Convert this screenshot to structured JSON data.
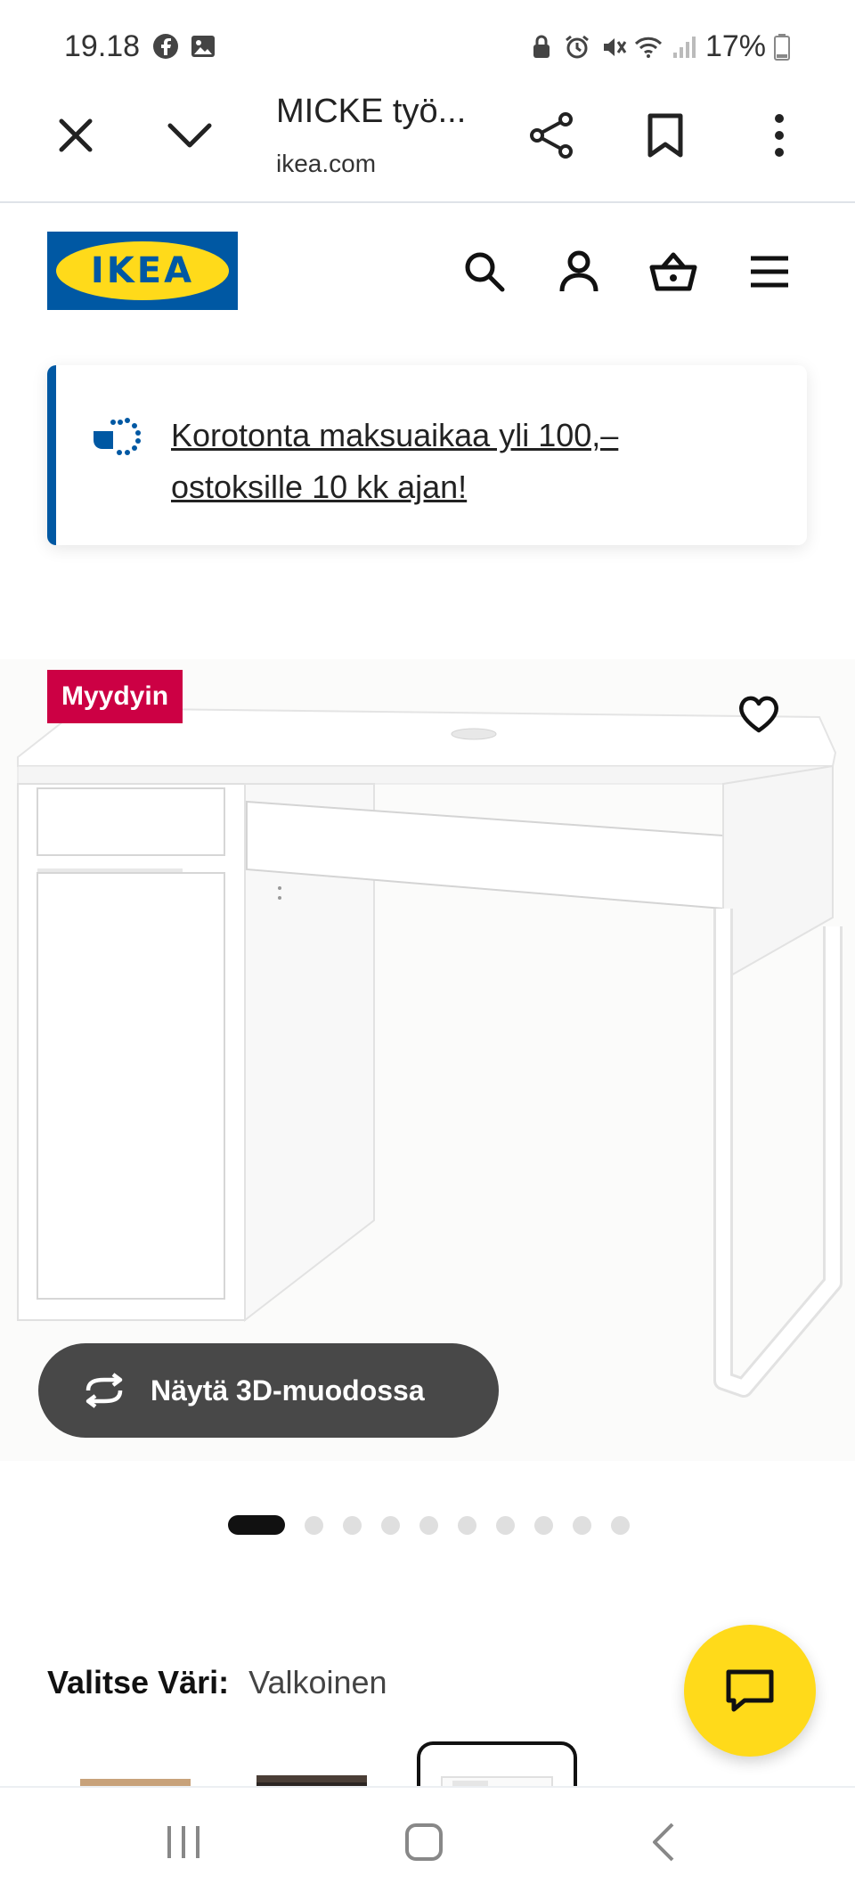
{
  "status_bar": {
    "time": "19.18",
    "battery": "17%",
    "left_icons": [
      "facebook-icon",
      "image-icon"
    ],
    "right_icons": [
      "lock-icon",
      "alarm-icon",
      "mute-icon",
      "wifi-icon",
      "signal-icon",
      "battery-icon"
    ]
  },
  "browser": {
    "title": "MICKE työ...",
    "url": "ikea.com",
    "icons": [
      "close-icon",
      "chevron-down-icon",
      "share-icon",
      "bookmark-icon",
      "more-vert-icon"
    ]
  },
  "header": {
    "logo_text": "IKEA",
    "icons": [
      "search-icon",
      "account-icon",
      "basket-icon",
      "menu-icon"
    ]
  },
  "promo": {
    "text": "Korotonta maksuaikaa yli 100,– ostoksille 10 kk ajan!",
    "accent": "#0058a3"
  },
  "product": {
    "badge": "Myydyin",
    "badge_color": "#cc0044",
    "view_3d_label": "Näytä 3D-muodossa",
    "carousel_total": 10,
    "carousel_active": 1
  },
  "color_select": {
    "label": "Valitse Väri:",
    "value": "Valkoinen",
    "swatches": [
      "black-brown",
      "black-brown-dark",
      "white"
    ],
    "selected_index": 2
  },
  "colors": {
    "ikea_blue": "#0058a3",
    "ikea_yellow": "#ffda1a",
    "button_dark": "#484848"
  }
}
